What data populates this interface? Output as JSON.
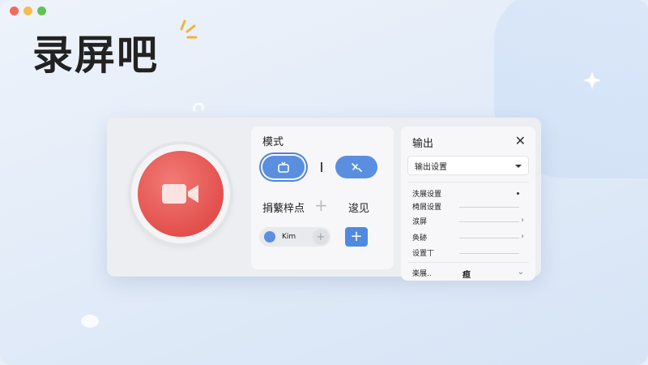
{
  "window": {
    "traffic_lights": [
      "close",
      "minimize",
      "zoom"
    ]
  },
  "app": {
    "title": "录屏吧"
  },
  "mode_panel": {
    "label": "模式",
    "row_labels": [
      "捐蘩梓点",
      "逡见"
    ],
    "chip_text": "Kim",
    "add_label": "+",
    "chip_add_label": "+",
    "plus_label": "+"
  },
  "output_panel": {
    "title": "输出",
    "close_label": "✕",
    "select_value": "输出设置",
    "settings": [
      {
        "label": "泆展设置",
        "kind": "dot"
      },
      {
        "label": "椅屑设置",
        "kind": "line"
      },
      {
        "label": "涙屏",
        "kind": "arrow"
      },
      {
        "label": "奂硛",
        "kind": "arrow"
      },
      {
        "label": "设置丅",
        "kind": "line"
      }
    ],
    "footer_label": "楽展..",
    "footer_value": "疸",
    "footer_chevron": "⌄"
  },
  "colors": {
    "record": "#e3504d",
    "accent": "#5a8fe0"
  }
}
